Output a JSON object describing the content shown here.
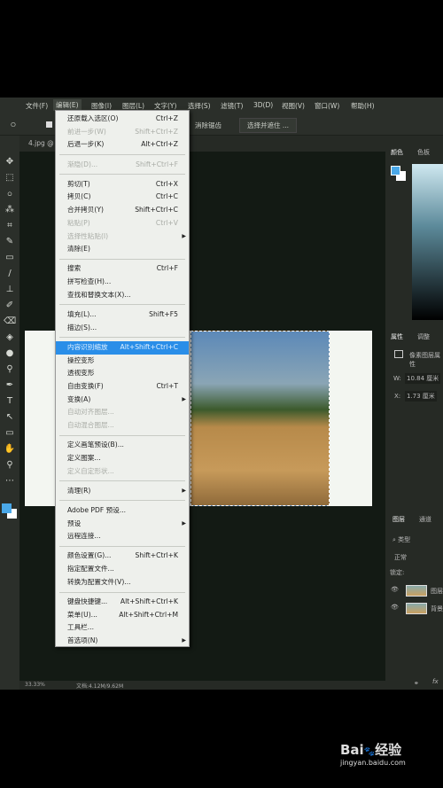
{
  "menubar": {
    "items": [
      "文件(F)",
      "编辑(E)",
      "图像(I)",
      "图层(L)",
      "文字(Y)",
      "选择(S)",
      "滤镜(T)",
      "3D(D)",
      "视图(V)",
      "窗口(W)",
      "帮助(H)"
    ],
    "active": "编辑(E)"
  },
  "options": {
    "feather_label": "消除锯齿",
    "select_mask_button": "选择并遮住 ..."
  },
  "document": {
    "tab": "4.jpg @"
  },
  "status": {
    "zoom": "33.33%",
    "doc_size": "文档:4.12M/9.62M"
  },
  "edit_menu": [
    {
      "label": "还原载入选区(O)",
      "shortcut": "Ctrl+Z"
    },
    {
      "label": "前进一步(W)",
      "shortcut": "Shift+Ctrl+Z",
      "disabled": true
    },
    {
      "label": "后退一步(K)",
      "shortcut": "Alt+Ctrl+Z"
    },
    {
      "sep": true
    },
    {
      "label": "渐隐(D)...",
      "shortcut": "Shift+Ctrl+F",
      "disabled": true
    },
    {
      "sep": true
    },
    {
      "label": "剪切(T)",
      "shortcut": "Ctrl+X"
    },
    {
      "label": "拷贝(C)",
      "shortcut": "Ctrl+C"
    },
    {
      "label": "合并拷贝(Y)",
      "shortcut": "Shift+Ctrl+C"
    },
    {
      "label": "粘贴(P)",
      "shortcut": "Ctrl+V",
      "disabled": true
    },
    {
      "label": "选择性粘贴(I)",
      "disabled": true,
      "submenu": true
    },
    {
      "label": "清除(E)"
    },
    {
      "sep": true
    },
    {
      "label": "搜索",
      "shortcut": "Ctrl+F"
    },
    {
      "label": "拼写检查(H)..."
    },
    {
      "label": "查找和替换文本(X)..."
    },
    {
      "sep": true
    },
    {
      "label": "填充(L)...",
      "shortcut": "Shift+F5"
    },
    {
      "label": "描边(S)..."
    },
    {
      "sep": true
    },
    {
      "label": "内容识别缩放",
      "shortcut": "Alt+Shift+Ctrl+C",
      "highlighted": true
    },
    {
      "label": "操控变形"
    },
    {
      "label": "透视变形"
    },
    {
      "label": "自由变换(F)",
      "shortcut": "Ctrl+T"
    },
    {
      "label": "变换(A)",
      "submenu": true
    },
    {
      "label": "自动对齐图层...",
      "disabled": true
    },
    {
      "label": "自动混合图层...",
      "disabled": true
    },
    {
      "sep": true
    },
    {
      "label": "定义画笔预设(B)..."
    },
    {
      "label": "定义图案..."
    },
    {
      "label": "定义自定形状...",
      "disabled": true
    },
    {
      "sep": true
    },
    {
      "label": "清理(R)",
      "submenu": true
    },
    {
      "sep": true
    },
    {
      "label": "Adobe PDF 预设..."
    },
    {
      "label": "预设",
      "submenu": true
    },
    {
      "label": "远程连接..."
    },
    {
      "sep": true
    },
    {
      "label": "颜色设置(G)...",
      "shortcut": "Shift+Ctrl+K"
    },
    {
      "label": "指定配置文件..."
    },
    {
      "label": "转换为配置文件(V)..."
    },
    {
      "sep": true
    },
    {
      "label": "键盘快捷键...",
      "shortcut": "Alt+Shift+Ctrl+K"
    },
    {
      "label": "菜单(U)...",
      "shortcut": "Alt+Shift+Ctrl+M"
    },
    {
      "label": "工具栏..."
    },
    {
      "label": "首选项(N)",
      "submenu": true
    }
  ],
  "panels": {
    "color_tabs": [
      "颜色",
      "色板"
    ],
    "props_tabs": [
      "属性",
      "调整"
    ],
    "props_title": "像素图层属性",
    "w_label": "W:",
    "w_value": "10.84 厘米",
    "x_label": "X:",
    "x_value": "1.73 厘米",
    "layers_tabs": [
      "图层",
      "通道"
    ],
    "filter": "类型",
    "blend": "正常",
    "lock_label": "锁定:",
    "layers": [
      "图层",
      "背景"
    ]
  },
  "colors": {
    "foreground": "#4aa8e8",
    "background": "#ffffff",
    "highlight": "#2a8ee8"
  },
  "watermark": {
    "brand": "Bai du 经验",
    "url": "jingyan.baidu.com"
  }
}
